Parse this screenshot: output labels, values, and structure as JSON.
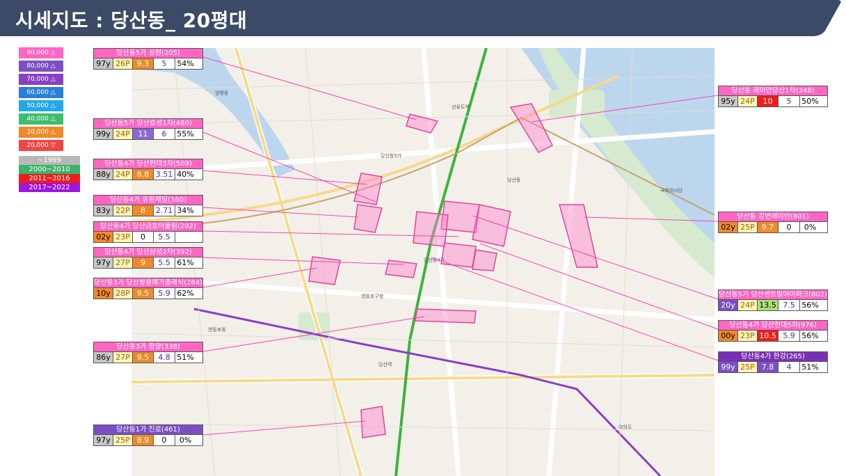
{
  "title": "시세지도 : 당산동_ 20평대",
  "price_legend": [
    {
      "label": "90,000 △",
      "color": "#ff66c4"
    },
    {
      "label": "80,000 △",
      "color": "#7b4fc4"
    },
    {
      "label": "70,000 △",
      "color": "#8a3ec8"
    },
    {
      "label": "60,000 △",
      "color": "#2a7fd8"
    },
    {
      "label": "50,000 △",
      "color": "#23a8e8"
    },
    {
      "label": "40,000 △",
      "color": "#3dbd6f"
    },
    {
      "label": "30,000 △",
      "color": "#f08a28"
    },
    {
      "label": "20,000 ▽",
      "color": "#ef4646"
    }
  ],
  "year_legend": [
    {
      "label": "~1999",
      "color": "#b8b8b8"
    },
    {
      "label": "2000~2010",
      "color": "#3bb36a"
    },
    {
      "label": "2011~2016",
      "color": "#ee1c1c"
    },
    {
      "label": "2017~2022",
      "color": "#9b16e0"
    }
  ],
  "callouts": [
    {
      "name": "당산동5가 성원(205)",
      "header_color": "#ff66c4",
      "age": "97y",
      "age_bg": "#c8c8c8",
      "pyeong": "26P",
      "price": "9.3",
      "price_bg": "#f08a28",
      "price_fg": "#ffffff",
      "rent": "5",
      "rent_fg": "#3a2bb0",
      "ratio": "54%"
    },
    {
      "name": "당산동5가 당산효성1차(480)",
      "header_color": "#ff66c4",
      "age": "99y",
      "age_bg": "#c8c8c8",
      "pyeong": "24P",
      "price": "11",
      "price_bg": "#8a68d8",
      "price_fg": "#ffffff",
      "rent": "6",
      "rent_fg": "#3a2bb0",
      "ratio": "55%"
    },
    {
      "name": "당산동4가 당산현대3차(509)",
      "header_color": "#ff66c4",
      "age": "88y",
      "age_bg": "#c8c8c8",
      "pyeong": "24P",
      "price": "8.8",
      "price_bg": "#f08a28",
      "price_fg": "#ffffff",
      "rent": "3.51",
      "rent_fg": "#3a2bb0",
      "ratio": "40%"
    },
    {
      "name": "당산동4가 유원제일(360)",
      "header_color": "#ff66c4",
      "age": "83y",
      "age_bg": "#c8c8c8",
      "pyeong": "22P",
      "price": "8",
      "price_bg": "#f08a28",
      "price_fg": "#ffffff",
      "rent": "2.71",
      "rent_fg": "#3a2bb0",
      "ratio": "34%"
    },
    {
      "name": "당산동4가 당산금호어울림(292)",
      "header_color": "#ff66c4",
      "age": "02y",
      "age_bg": "#f08a28",
      "pyeong": "23P",
      "price": "0",
      "price_bg": "#ffffff",
      "price_fg": "#000000",
      "rent": "5.5",
      "rent_fg": "#3a2bb0",
      "ratio": ""
    },
    {
      "name": "당산동4가 당산삼성2차(392)",
      "header_color": "#ff66c4",
      "age": "97y",
      "age_bg": "#c8c8c8",
      "pyeong": "27P",
      "price": "9",
      "price_bg": "#f08a28",
      "price_fg": "#ffffff",
      "rent": "5.5",
      "rent_fg": "#3a2bb0",
      "ratio": "61%"
    },
    {
      "name": "당산동3가 당산쌍용예가클래식(284)",
      "header_color": "#ff66c4",
      "age": "10y",
      "age_bg": "#f08a28",
      "pyeong": "28P",
      "price": "9.5",
      "price_bg": "#f08a28",
      "price_fg": "#ffffff",
      "rent": "5.9",
      "rent_fg": "#3a2bb0",
      "ratio": "62%"
    },
    {
      "name": "당산동3가 한양(338)",
      "header_color": "#ff66c4",
      "age": "86y",
      "age_bg": "#c8c8c8",
      "pyeong": "27P",
      "price": "9.5",
      "price_bg": "#f08a28",
      "price_fg": "#ffffff",
      "rent": "4.8",
      "rent_fg": "#3a2bb0",
      "ratio": "51%"
    },
    {
      "name": "당산동1가 진로(461)",
      "header_color": "#7b4fc4",
      "age": "97y",
      "age_bg": "#c8c8c8",
      "pyeong": "25P",
      "price": "8.9",
      "price_bg": "#f08a28",
      "price_fg": "#ffffff",
      "rent": "0",
      "rent_fg": "#000000",
      "ratio": "0%"
    },
    {
      "name": "당산동 래미안당산1차(348)",
      "header_color": "#ff66c4",
      "age": "95y",
      "age_bg": "#c8c8c8",
      "pyeong": "24P",
      "price": "10",
      "price_bg": "#ef1c1c",
      "price_fg": "#ffffff",
      "rent": "5",
      "rent_fg": "#3a2bb0",
      "ratio": "50%"
    },
    {
      "name": "당산동 강변래미안(801)",
      "header_color": "#ff66c4",
      "age": "02y",
      "age_bg": "#f08a28",
      "pyeong": "25P",
      "price": "9.7",
      "price_bg": "#f08a28",
      "price_fg": "#ffffff",
      "rent": "0",
      "rent_fg": "#000000",
      "ratio": "0%"
    },
    {
      "name": "당산동5가 당산센트럴아이파크(802)",
      "header_color": "#ff66c4",
      "age": "20y",
      "age_bg": "#7b4fc4",
      "pyeong": "24P",
      "price": "13.5",
      "price_bg": "#a8e07a",
      "price_fg": "#000000",
      "rent": "7.5",
      "rent_fg": "#3a2bb0",
      "ratio": "56%"
    },
    {
      "name": "당산동4가 당산현대5차(976)",
      "header_color": "#ff66c4",
      "age": "00y",
      "age_bg": "#f08a28",
      "pyeong": "23P",
      "price": "10.5",
      "price_bg": "#ef1c1c",
      "price_fg": "#ffffff",
      "rent": "5.9",
      "rent_fg": "#3a2bb0",
      "ratio": "56%"
    },
    {
      "name": "당산동4가 한강(265)",
      "header_color": "#7b2fb8",
      "age": "99y",
      "age_bg": "#7b4fc4",
      "pyeong": "25P",
      "price": "7.8",
      "price_bg": "#7b4fc4",
      "price_fg": "#ffffff",
      "rent": "4",
      "rent_fg": "#3a2bb0",
      "ratio": "51%"
    }
  ],
  "map_labels": [
    "당산동5가",
    "당산동4가",
    "당산동",
    "영등포구청",
    "당산역",
    "영등포동",
    "선유도역",
    "국회의사당",
    "여의도",
    "양평동"
  ]
}
